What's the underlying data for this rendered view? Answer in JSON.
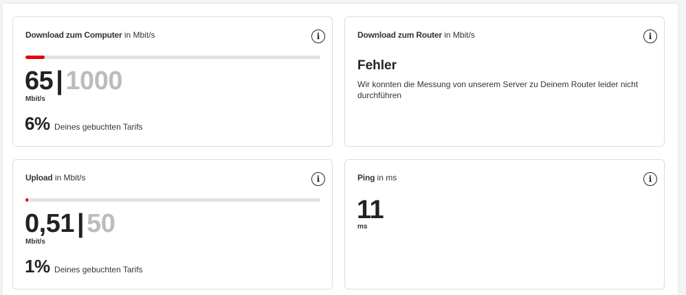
{
  "colors": {
    "accent": "#e60000",
    "track": "#dfe1e6",
    "max_value": "#bcbcbc"
  },
  "download_computer": {
    "title": "Download zum Computer",
    "title_unit": "in Mbit/s",
    "value": "65",
    "separator": "|",
    "max": "1000",
    "unit": "Mbit/s",
    "percent": "6%",
    "percent_text": "Deines gebuchten Tarifs",
    "progress": 0.065,
    "info_icon": "info-icon"
  },
  "download_router": {
    "title": "Download zum Router",
    "title_unit": "in Mbit/s",
    "error_heading": "Fehler",
    "error_text": "Wir konnten die Messung von unserem Server zu Deinem Router leider nicht durchführen",
    "info_icon": "info-icon"
  },
  "upload": {
    "title": "Upload",
    "title_unit": "in Mbit/s",
    "value": "0,51",
    "separator": "|",
    "max": "50",
    "unit": "Mbit/s",
    "percent": "1%",
    "percent_text": "Deines gebuchten Tarifs",
    "progress": 0.01,
    "info_icon": "info-icon"
  },
  "ping": {
    "title": "Ping",
    "title_unit": "in ms",
    "value": "11",
    "unit": "ms",
    "info_icon": "info-icon"
  }
}
